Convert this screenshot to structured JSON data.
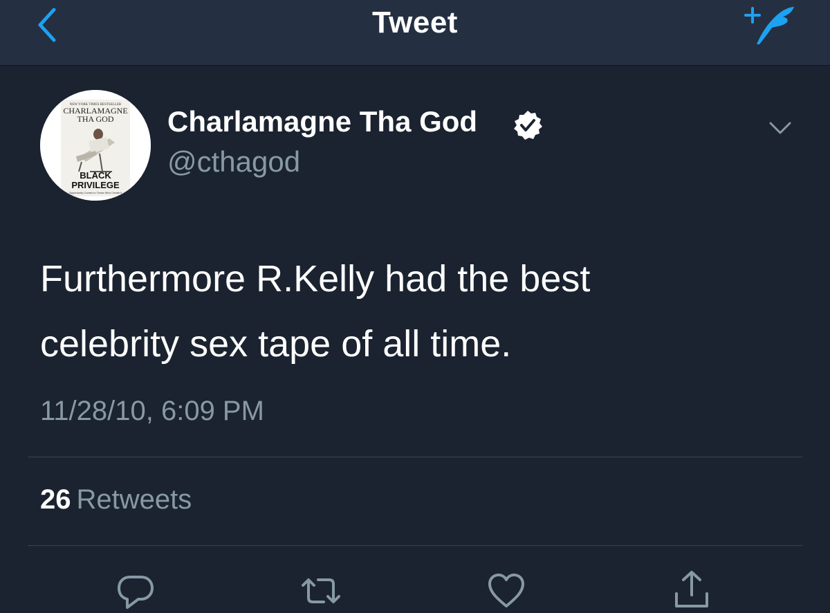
{
  "nav": {
    "title": "Tweet",
    "back_icon": "chevron-left-icon",
    "compose_icon": "compose-tweet-icon"
  },
  "colors": {
    "accent": "#1da1f2",
    "navbar_bg": "#243041",
    "page_bg": "#1b2330",
    "secondary_text": "#8899a6"
  },
  "author": {
    "display_name": "Charlamagne Tha God",
    "handle": "@cthagod",
    "verified": true,
    "avatar": {
      "top_text_small": "NEW YORK TIMES BESTSELLER",
      "top_text_line1": "CHARLAMAGNE",
      "top_text_line2": "THA GOD",
      "bottom_text_line1": "BLACK",
      "bottom_text_line2": "PRIVILEGE",
      "bottom_tagline": "Opportunity Comes to Those Who Create It"
    }
  },
  "tweet": {
    "text": "Furthermore R.Kelly had the best\ncelebrity sex tape of all time.",
    "timestamp": "11/28/10, 6:09 PM"
  },
  "stats": {
    "retweets_count": "26",
    "retweets_label": "Retweets"
  },
  "actions": {
    "reply_icon": "reply-icon",
    "retweet_icon": "retweet-icon",
    "like_icon": "heart-icon",
    "share_icon": "share-icon"
  }
}
